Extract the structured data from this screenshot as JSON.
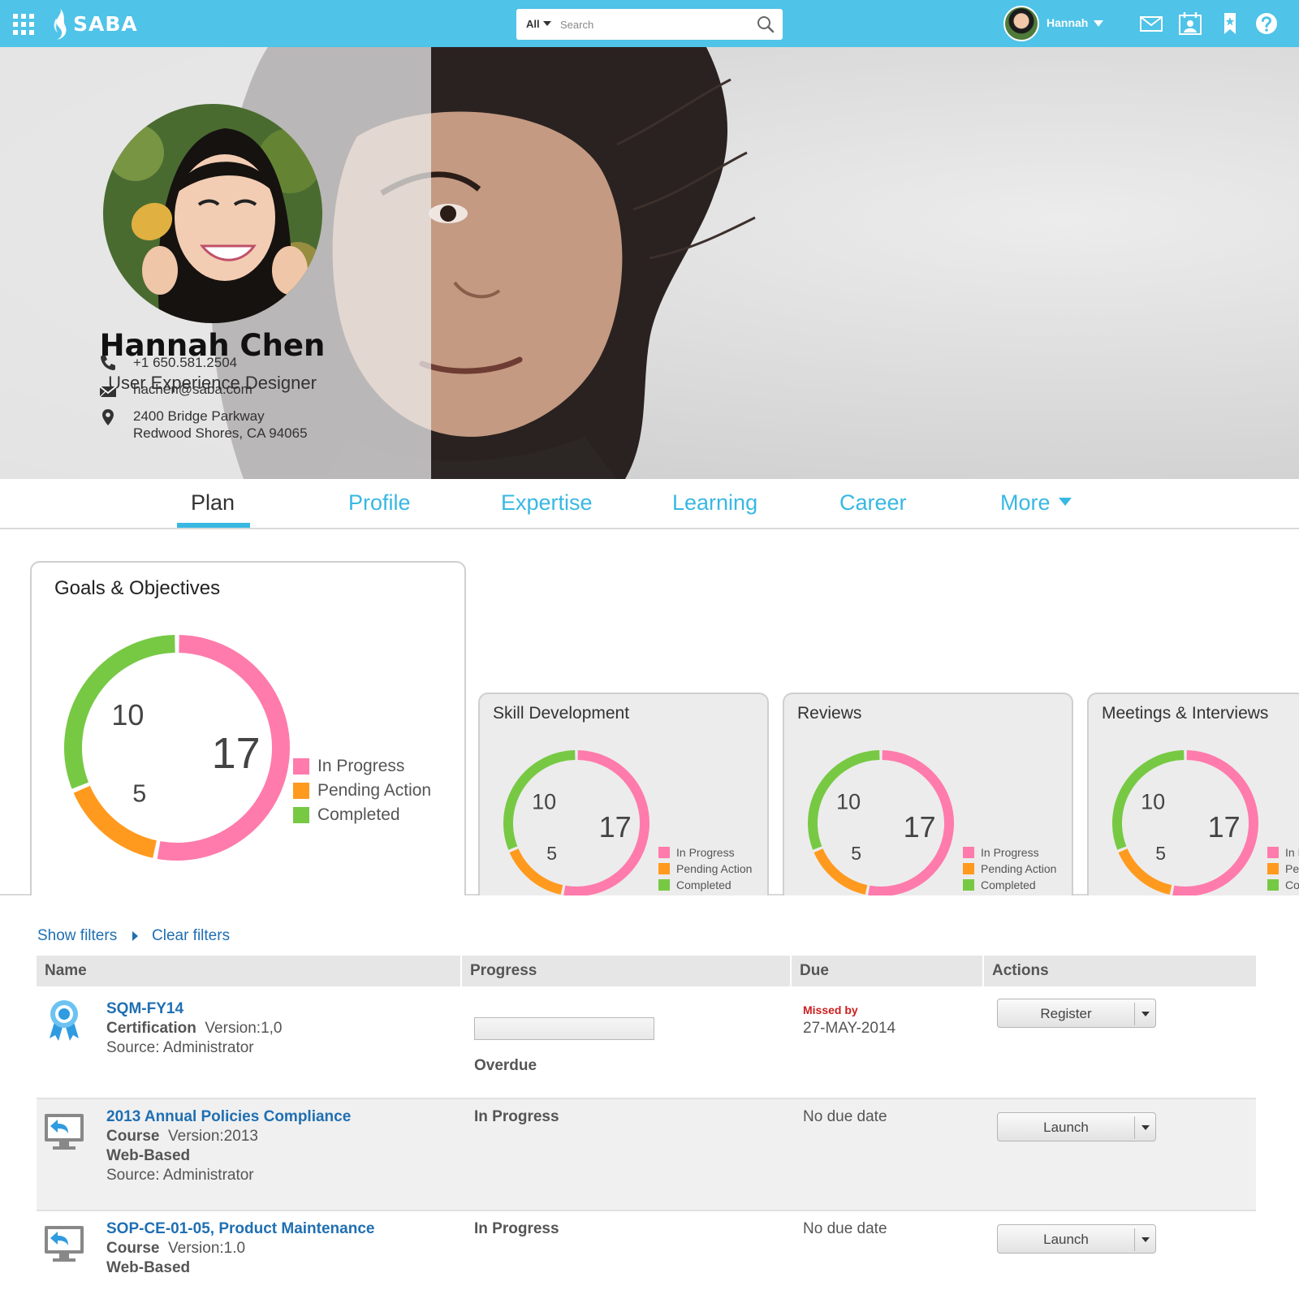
{
  "topbar": {
    "logo_text": "SABA",
    "search_scope": "All",
    "search_placeholder": "Search",
    "user_name": "Hannah"
  },
  "profile": {
    "name": "Hannah Chen",
    "title": "User Experience Designer",
    "phone": "+1 650.581.2504",
    "email": "hachen@saba.com",
    "address_line1": "2400 Bridge Parkway",
    "address_line2": "Redwood Shores, CA 94065"
  },
  "tabs": {
    "plan": "Plan",
    "profile": "Profile",
    "expertise": "Expertise",
    "learning": "Learning",
    "career": "Career",
    "more": "More"
  },
  "colors": {
    "brand": "#4fc3e8",
    "link": "#1f6fb2",
    "in_progress": "#ff7bac",
    "pending_action": "#ff9a1f",
    "completed": "#77c944"
  },
  "chart_data": [
    {
      "type": "pie",
      "title": "Goals & Objectives",
      "categories": [
        "In Progress",
        "Pending Action",
        "Completed"
      ],
      "values": [
        17,
        5,
        10
      ],
      "colors": [
        "#ff7bac",
        "#ff9a1f",
        "#77c944"
      ],
      "legend": "right"
    },
    {
      "type": "pie",
      "title": "Skill Development",
      "categories": [
        "In Progress",
        "Pending Action",
        "Completed"
      ],
      "values": [
        17,
        5,
        10
      ],
      "colors": [
        "#ff7bac",
        "#ff9a1f",
        "#77c944"
      ],
      "legend": "right"
    },
    {
      "type": "pie",
      "title": "Reviews",
      "categories": [
        "In Progress",
        "Pending Action",
        "Completed"
      ],
      "values": [
        17,
        5,
        10
      ],
      "colors": [
        "#ff7bac",
        "#ff9a1f",
        "#77c944"
      ],
      "legend": "right"
    },
    {
      "type": "pie",
      "title": "Meetings & Interviews",
      "categories": [
        "In Progress",
        "Pending Action",
        "Completed"
      ],
      "values": [
        17,
        5,
        10
      ],
      "colors": [
        "#ff7bac",
        "#ff9a1f",
        "#77c944"
      ],
      "legend": "right"
    }
  ],
  "filters": {
    "show": "Show filters",
    "clear": "Clear filters"
  },
  "table": {
    "columns": [
      "Name",
      "Progress",
      "Due",
      "Actions"
    ],
    "rows": [
      {
        "icon": "certification-ribbon-icon",
        "name": "SQM-FY14",
        "type": "Certification",
        "version": "Version:1,0",
        "source": "Source: Administrator",
        "progress": "Overdue",
        "due_label": "Missed by",
        "due": "27-MAY-2014",
        "action": "Register"
      },
      {
        "icon": "web-course-icon",
        "name": "2013 Annual Policies Compliance",
        "type": "Course",
        "version": "Version:2013",
        "delivery": "Web-Based",
        "source": "Source: Administrator",
        "progress": "In Progress",
        "due": "No due date",
        "action": "Launch"
      },
      {
        "icon": "web-course-icon",
        "name": "SOP-CE-01-05, Product Maintenance",
        "type": "Course",
        "version": "Version:1.0",
        "delivery": "Web-Based",
        "progress": "In Progress",
        "due": "No due date",
        "action": "Launch"
      }
    ]
  }
}
